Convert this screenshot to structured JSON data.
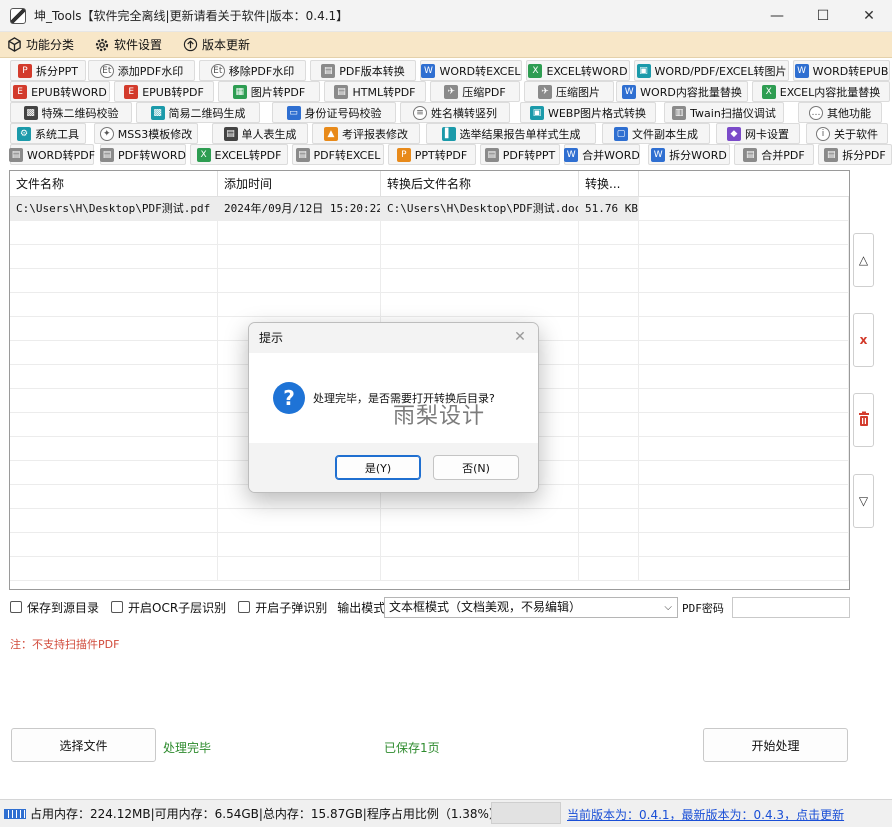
{
  "window": {
    "title": "坤_Tools【软件完全离线|更新请看关于软件|版本：0.4.1】",
    "minimize": "—",
    "maximize": "☐",
    "close": "✕"
  },
  "menu": [
    {
      "label": "功能分类",
      "icon": "cube-icon"
    },
    {
      "label": "软件设置",
      "icon": "gear-icon"
    },
    {
      "label": "版本更新",
      "icon": "up-arrow-circle-icon"
    }
  ],
  "toolbar_rows": [
    [
      {
        "label": "拆分PPT",
        "color": "red",
        "glyph": "P"
      },
      {
        "label": "添加PDF水印",
        "color": "round",
        "glyph": "Et"
      },
      {
        "label": "移除PDF水印",
        "color": "round",
        "glyph": "Et"
      },
      {
        "label": "PDF版本转换",
        "color": "gray",
        "glyph": "▤"
      },
      {
        "label": "WORD转EXCEL",
        "color": "blue",
        "glyph": "W"
      },
      {
        "label": "EXCEL转WORD",
        "color": "green",
        "glyph": "X"
      },
      {
        "label": "WORD/PDF/EXCEL转图片",
        "color": "teal",
        "glyph": "▣"
      },
      {
        "label": "WORD转EPUB",
        "color": "blue",
        "glyph": "W"
      }
    ],
    [
      {
        "label": "EPUB转WORD",
        "color": "red",
        "glyph": "E"
      },
      {
        "label": "EPUB转PDF",
        "color": "red",
        "glyph": "E"
      },
      {
        "label": "图片转PDF",
        "color": "green",
        "glyph": "▦"
      },
      {
        "label": "HTML转PDF",
        "color": "gray",
        "glyph": "▤"
      },
      {
        "label": "压缩PDF",
        "color": "gray",
        "glyph": "✈"
      },
      {
        "label": "压缩图片",
        "color": "gray",
        "glyph": "✈"
      },
      {
        "label": "WORD内容批量替换",
        "color": "blue",
        "glyph": "W"
      },
      {
        "label": "EXCEL内容批量替换",
        "color": "green",
        "glyph": "X"
      }
    ],
    [
      {
        "label": "特殊二维码校验",
        "color": "dark",
        "glyph": "▩"
      },
      {
        "label": "简易二维码生成",
        "color": "teal",
        "glyph": "▩"
      },
      {
        "label": "身份证号码校验",
        "color": "blue",
        "glyph": "▭"
      },
      {
        "label": "姓名横转竖列",
        "color": "round",
        "glyph": "≡"
      },
      {
        "label": "WEBP图片格式转换",
        "color": "teal",
        "glyph": "▣"
      },
      {
        "label": "Twain扫描仪调试",
        "color": "gray",
        "glyph": "▥"
      },
      {
        "label": "其他功能",
        "color": "round",
        "glyph": "…"
      }
    ],
    [
      {
        "label": "系统工具",
        "color": "teal",
        "glyph": "⚙"
      },
      {
        "label": "MSS3模板修改",
        "color": "round",
        "glyph": "✦"
      },
      {
        "label": "单人表生成",
        "color": "dark",
        "glyph": "▤"
      },
      {
        "label": "考评报表修改",
        "color": "orange",
        "glyph": "▲"
      },
      {
        "label": "选举结果报告单样式生成",
        "color": "teal",
        "glyph": "▌"
      },
      {
        "label": "文件副本生成",
        "color": "blue",
        "glyph": "▢"
      },
      {
        "label": "网卡设置",
        "color": "purple",
        "glyph": "◆"
      },
      {
        "label": "关于软件",
        "color": "round",
        "glyph": "i"
      }
    ],
    [
      {
        "label": "WORD转PDF",
        "color": "gray",
        "glyph": "▤"
      },
      {
        "label": "PDF转WORD",
        "color": "gray",
        "glyph": "▤"
      },
      {
        "label": "EXCEL转PDF",
        "color": "green",
        "glyph": "X"
      },
      {
        "label": "PDF转EXCEL",
        "color": "gray",
        "glyph": "▤"
      },
      {
        "label": "PPT转PDF",
        "color": "orange",
        "glyph": "P"
      },
      {
        "label": "PDF转PPT",
        "color": "gray",
        "glyph": "▤"
      },
      {
        "label": "合并WORD",
        "color": "blue",
        "glyph": "W"
      },
      {
        "label": "拆分WORD",
        "color": "blue",
        "glyph": "W"
      },
      {
        "label": "合并PDF",
        "color": "gray",
        "glyph": "▤"
      },
      {
        "label": "拆分PDF",
        "color": "gray",
        "glyph": "▤"
      }
    ]
  ],
  "table": {
    "columns": [
      "文件名称",
      "添加时间",
      "转换后文件名称",
      "转换..."
    ],
    "rows": [
      [
        "C:\\Users\\H\\Desktop\\PDF测试.pdf",
        "2024年/09月/12日 15:20:22",
        "C:\\Users\\H\\Desktop\\PDF测试.docx",
        "51.76 KB"
      ]
    ]
  },
  "side_buttons": {
    "up": "△",
    "remove": "x",
    "delete": "trash-icon",
    "down": "▽"
  },
  "options": {
    "save_to_source": "保存到源目录",
    "ocr_layer": "开启OCR子层识别",
    "sub_recognition": "开启子弹识别",
    "output_mode_label": "输出模式",
    "output_mode_value": "文本框模式（文档美观，不易编辑）",
    "pdf_password_label": "PDF密码",
    "pdf_password_value": ""
  },
  "note": "注：不支持扫描件PDF",
  "bottom": {
    "select_file": "选择文件",
    "status_done": "处理完毕",
    "saved_pages": "已保存1页",
    "start": "开始处理"
  },
  "statusbar": {
    "memory": "占用内存：224.12MB|可用内存：6.54GB|总内存：15.87GB|程序占用比例（1.38%）",
    "version": "当前版本为：0.4.1，最新版本为：0.4.3，点击更新"
  },
  "dialog": {
    "title": "提示",
    "message": "处理完毕，是否需要打开转换后目录?",
    "yes": "是(Y)",
    "no": "否(N)"
  },
  "watermark": "雨梨设计"
}
